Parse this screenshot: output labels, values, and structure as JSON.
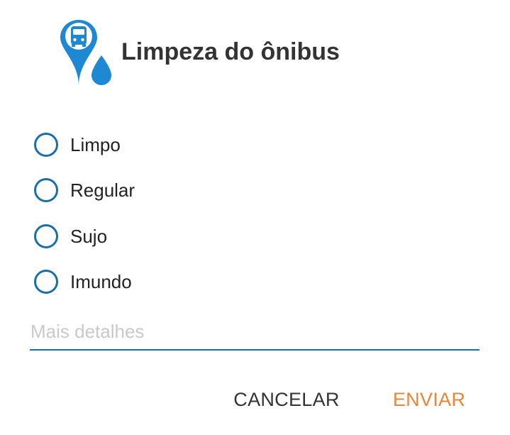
{
  "dialog": {
    "title": "Limpeza do ônibus",
    "icon": "bus-location-pin-with-water-drop-icon"
  },
  "options": [
    {
      "label": "Limpo",
      "selected": false
    },
    {
      "label": "Regular",
      "selected": false
    },
    {
      "label": "Sujo",
      "selected": false
    },
    {
      "label": "Imundo",
      "selected": false
    }
  ],
  "details": {
    "placeholder": "Mais detalhes",
    "value": ""
  },
  "actions": {
    "cancel_label": "CANCELAR",
    "send_label": "ENVIAR"
  },
  "colors": {
    "accent_blue": "#1b6fa5",
    "icon_blue": "#1e88d2",
    "send_orange": "#e8873a",
    "title_text": "#333333"
  }
}
